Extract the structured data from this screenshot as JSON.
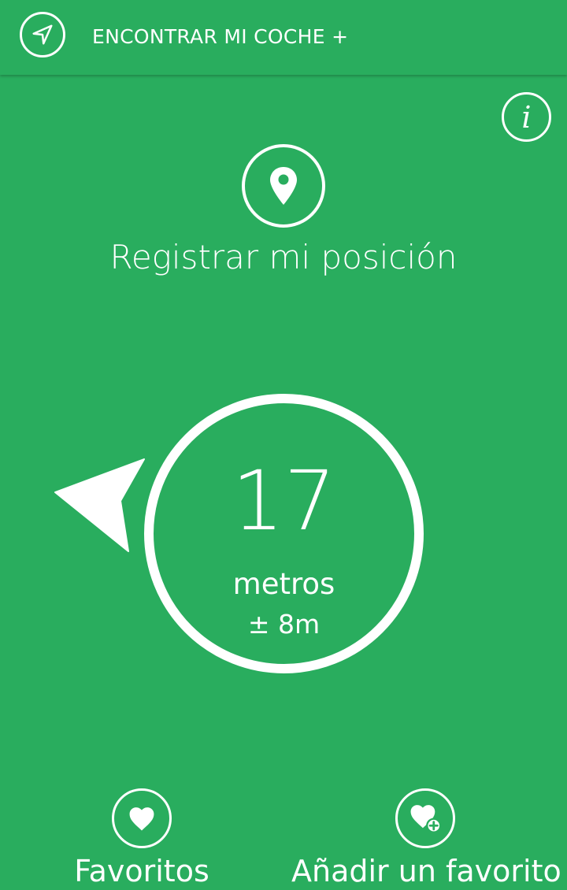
{
  "app_bar": {
    "title": "ENCONTRAR MI COCHE +",
    "app_icon": "navigation-arrow-icon"
  },
  "info_button": {
    "icon": "info-icon",
    "glyph": "i"
  },
  "register": {
    "icon": "location-pin-icon",
    "label": "Registrar mi posición"
  },
  "distance": {
    "value": "17",
    "unit": "metros",
    "accuracy": "± 8m",
    "direction_icon": "direction-arrow-icon"
  },
  "bottom_actions": {
    "favorites": {
      "icon": "heart-icon",
      "label": "Favoritos"
    },
    "add_favorite": {
      "icon": "heart-plus-icon",
      "label": "Añadir un favorito"
    }
  },
  "colors": {
    "background": "#29ad5e",
    "foreground": "#ffffff"
  }
}
